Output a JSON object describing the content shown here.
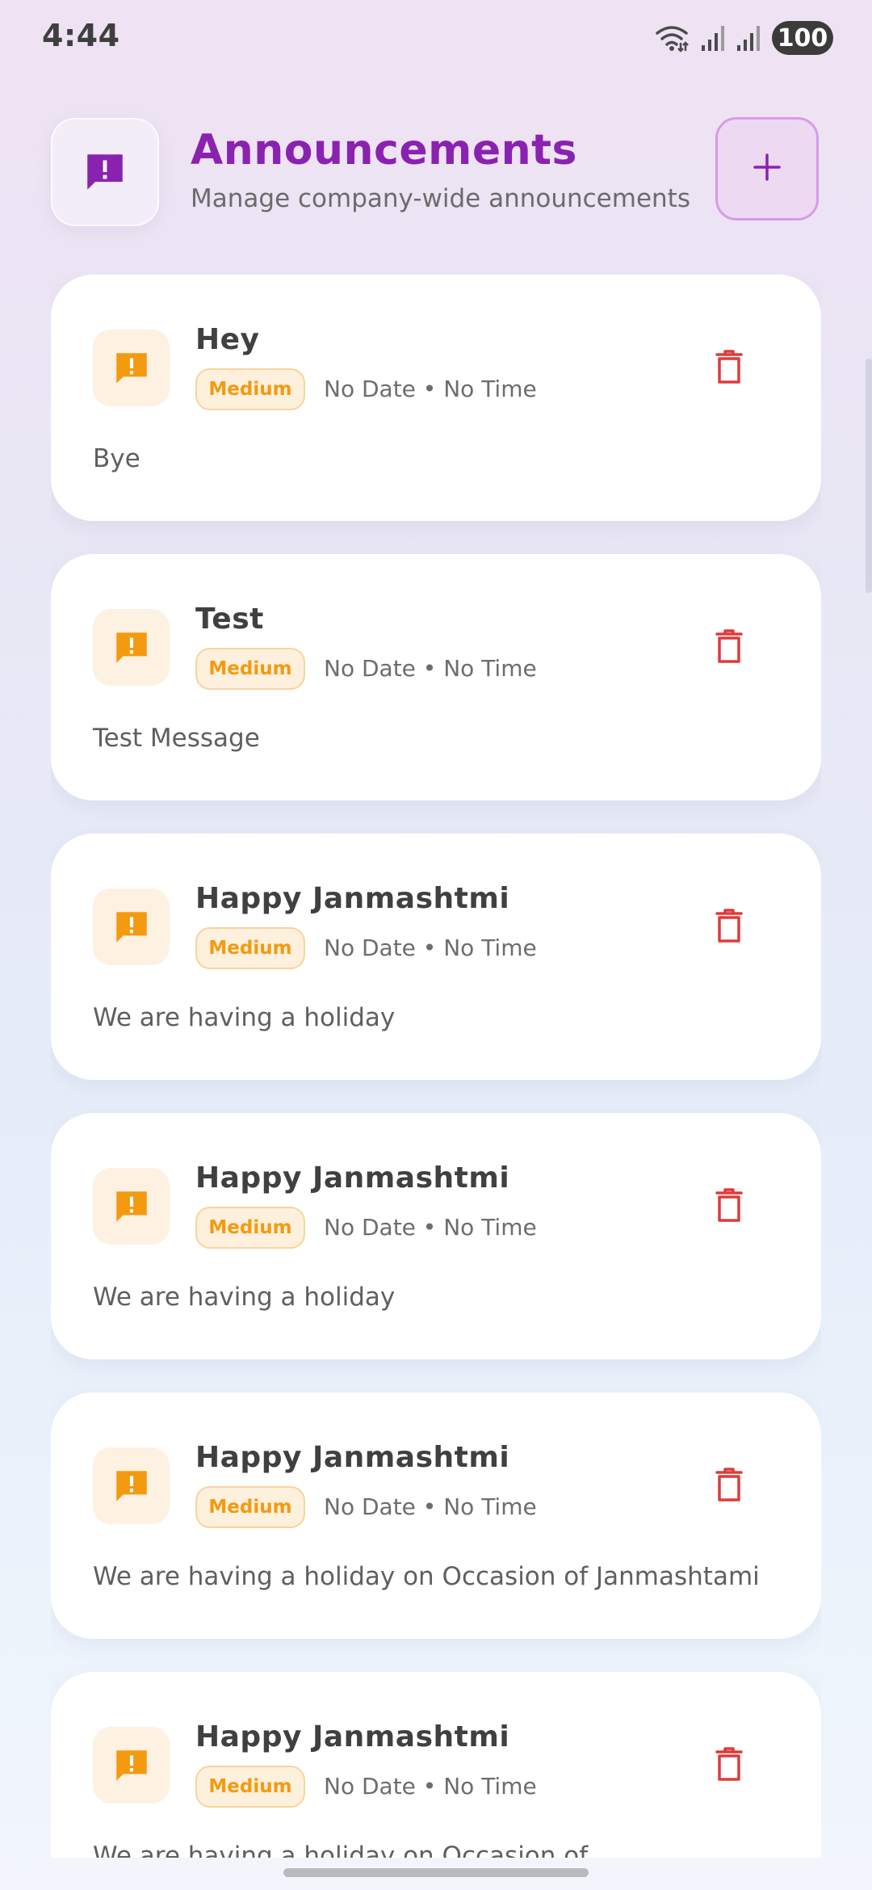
{
  "status_bar": {
    "time": "4:44",
    "battery": "100",
    "icons": [
      "wifi-icon",
      "signal-icon",
      "signal-icon"
    ]
  },
  "header": {
    "icon": "announcement-icon",
    "title": "Announcements",
    "subtitle": "Manage company-wide announcements",
    "add_icon": "plus-icon"
  },
  "colors": {
    "accent": "#8a22b0",
    "priority_medium": "#f39a11",
    "delete": "#e03a3a"
  },
  "announcements": [
    {
      "title": "Hey",
      "priority": "Medium",
      "meta": "No Date • No Time",
      "message": "Bye",
      "icon": "announcement-icon",
      "delete_icon": "trash-icon"
    },
    {
      "title": "Test",
      "priority": "Medium",
      "meta": "No Date • No Time",
      "message": "Test Message",
      "icon": "announcement-icon",
      "delete_icon": "trash-icon"
    },
    {
      "title": "Happy Janmashtmi",
      "priority": "Medium",
      "meta": "No Date • No Time",
      "message": "We are having a holiday",
      "icon": "announcement-icon",
      "delete_icon": "trash-icon"
    },
    {
      "title": "Happy Janmashtmi",
      "priority": "Medium",
      "meta": "No Date • No Time",
      "message": "We are having a holiday",
      "icon": "announcement-icon",
      "delete_icon": "trash-icon"
    },
    {
      "title": "Happy Janmashtmi",
      "priority": "Medium",
      "meta": "No Date • No Time",
      "message": "We are having a holiday on Occasion of Janmashtami",
      "icon": "announcement-icon",
      "delete_icon": "trash-icon"
    },
    {
      "title": "Happy Janmashtmi",
      "priority": "Medium",
      "meta": "No Date • No Time",
      "message": "We are having a holiday on Occasion of",
      "icon": "announcement-icon",
      "delete_icon": "trash-icon"
    }
  ]
}
